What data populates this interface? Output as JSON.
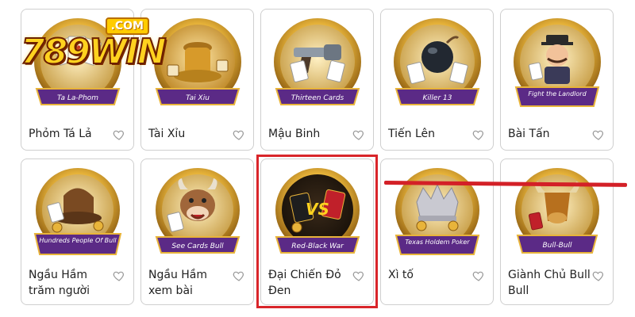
{
  "logo": {
    "brand": "789WIN",
    "suffix": ".COM"
  },
  "games": [
    {
      "name": "Phỏm Tá Lả",
      "banner": "Ta La-Phom"
    },
    {
      "name": "Tài Xỉu",
      "banner": "Tai Xiu"
    },
    {
      "name": "Mậu Binh",
      "banner": "Thirteen Cards"
    },
    {
      "name": "Tiến Lên",
      "banner": "Killer 13"
    },
    {
      "name": "Bài Tấn",
      "banner": "Fight the Landlord"
    },
    {
      "name": "Ngầu Hầm trăm người",
      "banner": "Hundreds People Of Bull"
    },
    {
      "name": "Ngầu Hầm xem bài",
      "banner": "See Cards Bull"
    },
    {
      "name": "Đại Chiến Đỏ Đen",
      "banner": "Red-Black War"
    },
    {
      "name": "Xì tố",
      "banner": "Texas Holdem Poker"
    },
    {
      "name": "Giành Chủ Bull Bull",
      "banner": "Bull-Bull"
    }
  ],
  "colors": {
    "gold": "#e8b43a",
    "purple": "#5b2a86",
    "highlight": "#d9252a",
    "card_border": "#cfcfcf"
  },
  "icons": {
    "favorite": "heart-outline-icon"
  }
}
